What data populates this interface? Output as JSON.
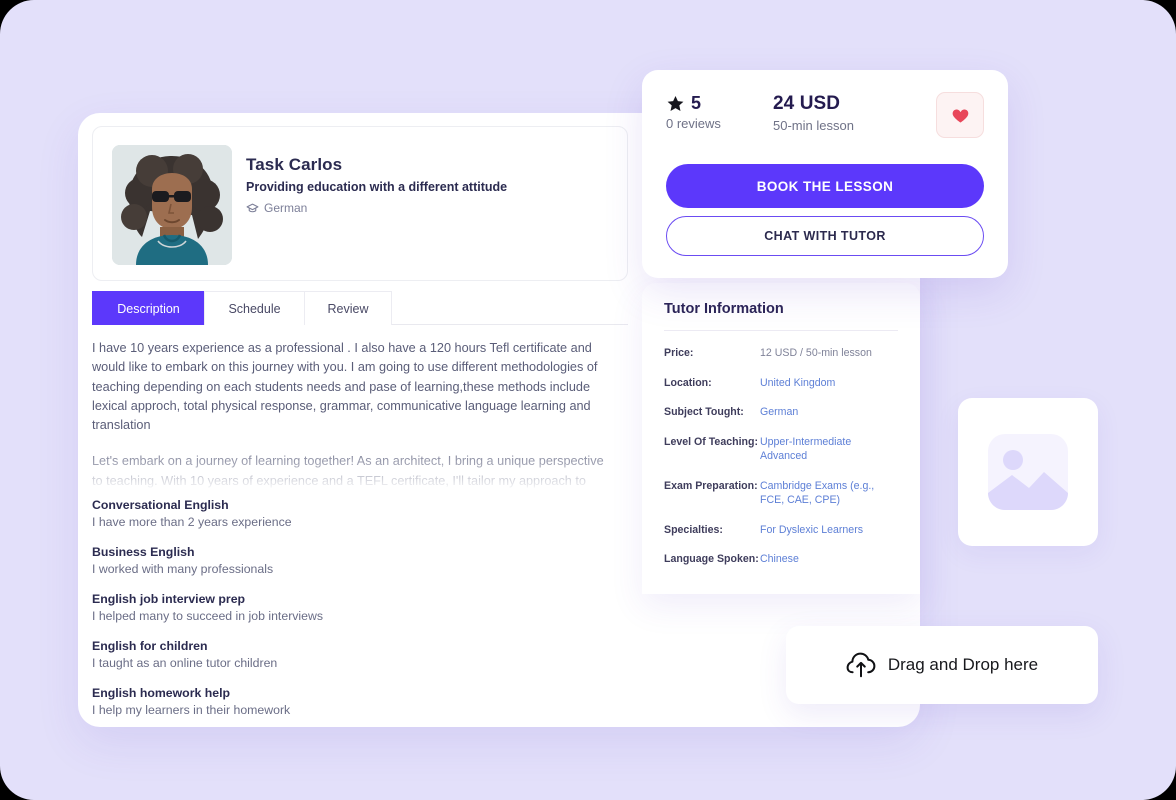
{
  "theme": {
    "canvas_bg": "#e3e0fa",
    "accent": "#5c38fb",
    "heading": "#2b2b50",
    "link": "#5d7fd6",
    "heart": "#e8475a"
  },
  "profile": {
    "avatar_alt": "tutor-portrait",
    "name": "Task Carlos",
    "tagline": "Providing education with a different attitude",
    "subject_icon": "graduation-cap-icon",
    "subject": "German",
    "tabs": [
      {
        "label": "Description",
        "active": true
      },
      {
        "label": "Schedule",
        "active": false
      },
      {
        "label": "Review",
        "active": false
      }
    ],
    "description": {
      "paragraph_1": "I have 10 years experience as a professional . I also have a 120 hours Tefl certificate and would like to embark on this journey with you. I am going to use different methodologies of teaching depending on each students needs and pase of learning,these methods include lexical approch, total physical response, grammar, communicative language learning and translation",
      "paragraph_2": "Let's embark on a journey of learning together! As an architect, I bring a unique perspective to teaching. With 10 years of experience and a TEFL certificate, I'll tailor my approach to meet"
    },
    "skills": [
      {
        "title": "Conversational English",
        "desc": "I have more than 2 years experience"
      },
      {
        "title": "Business English",
        "desc": "I worked with many professionals"
      },
      {
        "title": "English job interview prep",
        "desc": "I helped many to succeed in job interviews"
      },
      {
        "title": "English for children",
        "desc": "I taught as an online tutor children"
      },
      {
        "title": "English homework help",
        "desc": "I help my learners in their homework"
      }
    ]
  },
  "booking": {
    "star_icon": "star-icon",
    "rating": "5",
    "reviews": "0 reviews",
    "price": "24 USD",
    "price_unit": "50-min lesson",
    "favorite_icon": "heart-icon",
    "book_label": "BOOK THE LESSON",
    "chat_label": "CHAT WITH TUTOR"
  },
  "tutor_information": {
    "title": "Tutor Information",
    "rows": [
      {
        "label": "Price:",
        "value": "12 USD / 50-min lesson",
        "plain": true
      },
      {
        "label": "Location:",
        "value": "United Kingdom",
        "plain": false
      },
      {
        "label": "Subject Tought:",
        "value": "German",
        "plain": false
      },
      {
        "label": "Level Of Teaching:",
        "value": "Upper-Intermediate Advanced",
        "plain": false
      },
      {
        "label": "Exam Preparation:",
        "value": "Cambridge Exams (e.g., FCE, CAE, CPE)",
        "plain": false
      },
      {
        "label": "Specialties:",
        "value": "For Dyslexic Learners",
        "plain": false
      },
      {
        "label": "Language Spoken:",
        "value": "Chinese",
        "plain": false
      }
    ]
  },
  "image_placeholder": {
    "icon": "image-placeholder-icon"
  },
  "dropzone": {
    "icon": "cloud-upload-icon",
    "label": "Drag and Drop here"
  }
}
